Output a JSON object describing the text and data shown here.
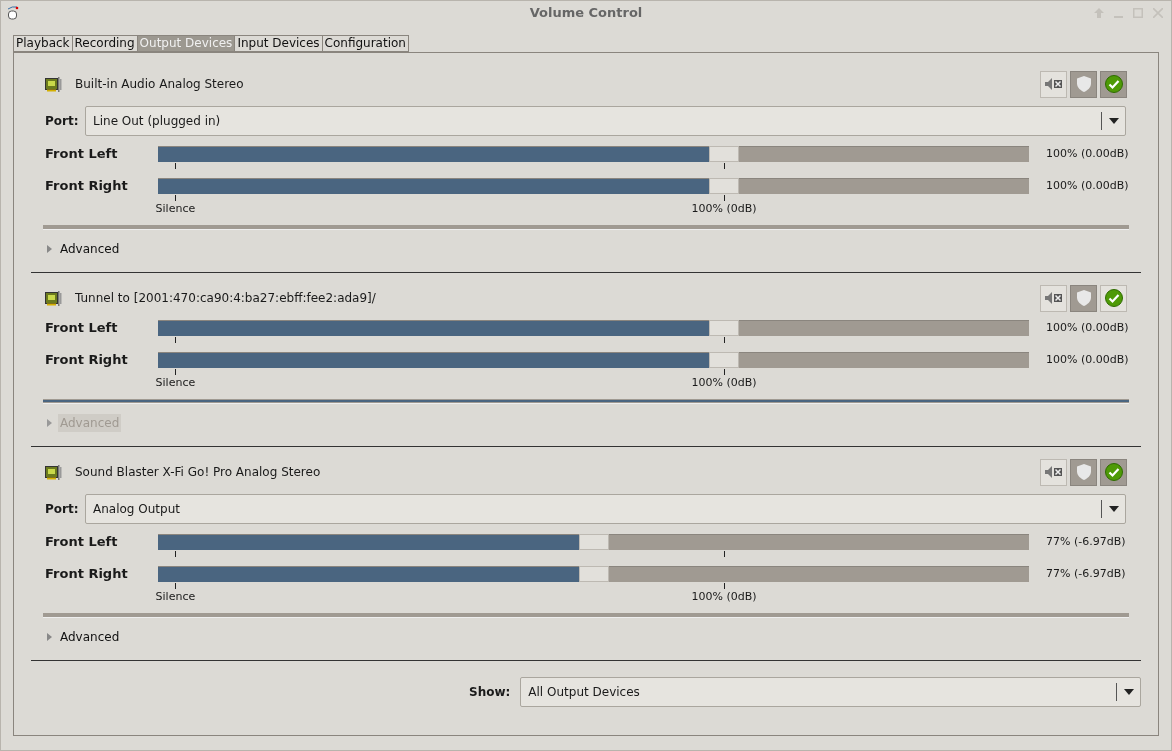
{
  "window": {
    "title": "Volume Control"
  },
  "tabs": [
    {
      "label": "Playback",
      "selected": false
    },
    {
      "label": "Recording",
      "selected": false
    },
    {
      "label": "Output Devices",
      "selected": true
    },
    {
      "label": "Input Devices",
      "selected": false
    },
    {
      "label": "Configuration",
      "selected": false
    }
  ],
  "devices": [
    {
      "name": "Built-in Audio Analog Stereo",
      "muted": false,
      "locked": true,
      "default": true,
      "port": {
        "label": "Port:",
        "value": "Line Out (plugged in)"
      },
      "channels": [
        {
          "name": "Front Left",
          "level": 0.65,
          "reading": "100% (0.00dB)"
        },
        {
          "name": "Front Right",
          "level": 0.65,
          "reading": "100% (0.00dB)"
        }
      ],
      "scale": [
        "Silence",
        "100% (0dB)"
      ],
      "meter": {
        "level": 0
      },
      "advanced": {
        "label": "Advanced",
        "disabled": false
      }
    },
    {
      "name": "Tunnel to [2001:470:ca90:4:ba27:ebff:fee2:ada9]/",
      "muted": false,
      "locked": true,
      "default": false,
      "channels": [
        {
          "name": "Front Left",
          "level": 0.65,
          "reading": "100% (0.00dB)"
        },
        {
          "name": "Front Right",
          "level": 0.65,
          "reading": "100% (0.00dB)"
        }
      ],
      "scale": [
        "Silence",
        "100% (0dB)"
      ],
      "meter": {
        "level": 1
      },
      "advanced": {
        "label": "Advanced",
        "disabled": true
      }
    },
    {
      "name": "Sound Blaster X-Fi Go! Pro Analog Stereo",
      "muted": false,
      "locked": true,
      "default": true,
      "port": {
        "label": "Port:",
        "value": "Analog Output"
      },
      "channels": [
        {
          "name": "Front Left",
          "level": 0.5,
          "reading": "77% (-6.97dB)"
        },
        {
          "name": "Front Right",
          "level": 0.5,
          "reading": "77% (-6.97dB)"
        }
      ],
      "scale": [
        "Silence",
        "100% (0dB)"
      ],
      "meter": {
        "level": 0
      },
      "advanced": {
        "label": "Advanced",
        "disabled": false
      }
    }
  ],
  "show": {
    "label": "Show:",
    "value": "All Output Devices"
  }
}
